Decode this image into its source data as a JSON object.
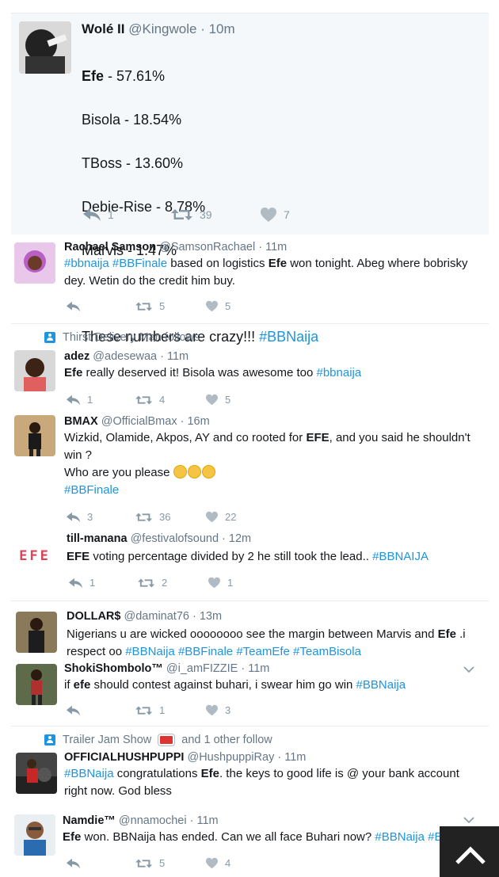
{
  "focused_tweet": {
    "name": "Wolé II",
    "handle": "@Kingwole",
    "time": "10m",
    "lines": [
      {
        "bold": "Efe",
        "rest": " - 57.61%"
      },
      {
        "bold": "",
        "rest": "Bisola - 18.54%"
      },
      {
        "bold": "",
        "rest": "TBoss - 13.60%"
      },
      {
        "bold": "",
        "rest": "Debie-Rise - 8.78%"
      },
      {
        "bold": "",
        "rest": "Marvis - 1.47%"
      }
    ],
    "closing_text": "These numbers are crazy!!!",
    "closing_tag": "#BBNaija",
    "replies": "1",
    "retweets": "39",
    "likes": "7"
  },
  "tweets": {
    "rachael": {
      "name": "Rachael Samson",
      "handle": "@SamsonRachael",
      "time": "11m",
      "tag1": "#bbnaija",
      "tag2": "#BBFinale",
      "t1": " based on logistics ",
      "b1": "Efe",
      "t2": " won tonight. Abeg where bobrisky dey. Wetin do the credit him buy.",
      "retweets": "5",
      "likes": "5"
    },
    "adez": {
      "social": "Thirst Delivery Man follows",
      "name": "adez",
      "handle": "@adesewaa",
      "time": "11m",
      "b1": "Efe",
      "t1": " really deserved it! Bisola was awesome too ",
      "tag1": "#bbnaija",
      "replies": "1",
      "retweets": "4",
      "likes": "5"
    },
    "bmax": {
      "name": "BMAX",
      "handle": "@OfficialBmax",
      "time": "16m",
      "t1": "Wizkid, Olamide, Akpos, AY and co rooted for ",
      "b1": "EFE",
      "t2": ", and you said he shouldn't win ?",
      "t3": "Who are you please ",
      "tag1": "#BBFinale",
      "replies": "3",
      "retweets": "36",
      "likes": "22"
    },
    "tillmanana": {
      "name": "till-manana",
      "handle": "@festivalofsound",
      "time": "12m",
      "b1": "EFE",
      "t1": " voting percentage divided by 2 he still took the lead.. ",
      "tag1": "#BBNAIJA",
      "avatar_text": "EFE",
      "replies": "1",
      "retweets": "2",
      "likes": "1"
    },
    "dollars": {
      "name": "DOLLAR$",
      "handle": "@daminat76",
      "time": "13m",
      "t1": "Nigerians u are wicked oooooooo see the margin between Marvis and ",
      "b1": "Efe",
      "t2": " .i respect oo ",
      "tag1": "#BBNaija",
      "tag2": "#BBFinale",
      "tag3": "#TeamEfe",
      "tag4": "#TeamBisola"
    },
    "shoki": {
      "name": "ShokiShombolo™",
      "handle": "@i_amFIZZIE",
      "time": "11m",
      "t1": "if ",
      "b1": "efe",
      "t2": " should contest against buhari, i swear him go win ",
      "tag1": "#BBNaija",
      "retweets": "1",
      "likes": "3"
    },
    "hushpuppi": {
      "social_a": "Trailer Jam Show",
      "social_b": "and 1 other follow",
      "name": "OFFICIALHUSHPUPPI",
      "handle": "@HushpuppiRay",
      "time": "11m",
      "tag1": "#BBNaija",
      "t1": " congratulations ",
      "b1": "Efe",
      "t2": ". the keys to good life is @ your bank account right now.  God bless"
    },
    "namdie": {
      "name": "Namdie™",
      "handle": "@nnamochei",
      "time": "11m",
      "b1": "Efe",
      "t1": " won. BBNaija has ended. Can we all face Buhari now? ",
      "tag1": "#BBNaija",
      "tag2": "#B",
      "retweets": "5",
      "likes": "4"
    }
  },
  "sep": " · ",
  "colors": {
    "link": "#1b95e0",
    "muted": "#657786",
    "icon": "#8899a6",
    "like_heart": "#b1bbc3"
  },
  "icons": [
    "reply-icon",
    "retweet-icon",
    "heart-icon",
    "chevron-down-icon",
    "person-icon",
    "scroll-top-icon"
  ]
}
